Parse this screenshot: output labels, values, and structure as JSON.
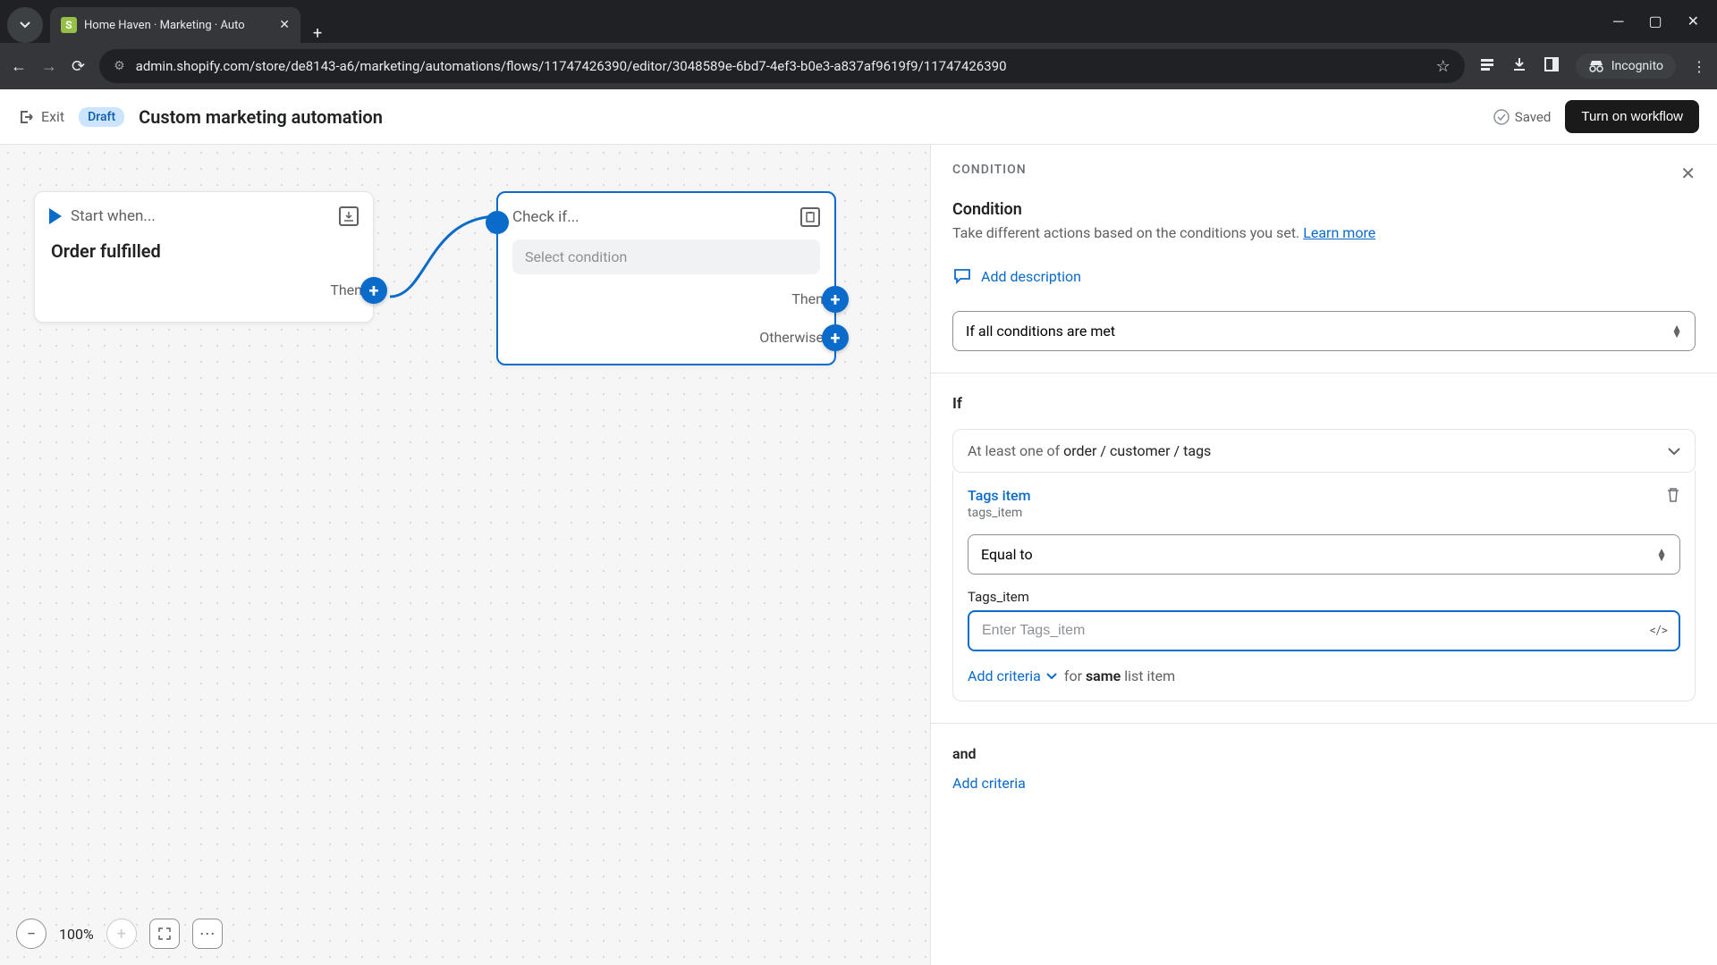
{
  "browser": {
    "tab_title": "Home Haven · Marketing · Auto",
    "url": "admin.shopify.com/store/de8143-a6/marketing/automations/flows/11747426390/editor/3048589e-6bd7-4ef3-b0e3-a837af9619f9/11747426390",
    "incognito": "Incognito"
  },
  "header": {
    "exit": "Exit",
    "draft_badge": "Draft",
    "title": "Custom marketing automation",
    "saved": "Saved",
    "turn_on": "Turn on workflow"
  },
  "canvas": {
    "start_node_title": "Start when...",
    "start_node_value": "Order fulfilled",
    "start_then": "Then",
    "check_node_title": "Check if...",
    "select_condition_placeholder": "Select condition",
    "check_then": "Then",
    "check_otherwise": "Otherwise",
    "zoom": "100%"
  },
  "panel": {
    "eyebrow": "CONDITION",
    "title": "Condition",
    "desc": "Take different actions based on the conditions you set. ",
    "learn_more": "Learn more",
    "add_description": "Add description",
    "match_mode": "If all conditions are met",
    "if_label": "If",
    "scope_prefix": "At least one of ",
    "scope_path": "order / customer / tags",
    "tags_item_title": "Tags item",
    "tags_item_sub": "tags_item",
    "operator": "Equal to",
    "input_label": "Tags_item",
    "input_placeholder": "Enter Tags_item",
    "add_criteria": "Add criteria",
    "for_same": "for ",
    "same": "same",
    "list_item": " list item",
    "and_label": "and",
    "add_criteria_bottom": "Add criteria"
  }
}
